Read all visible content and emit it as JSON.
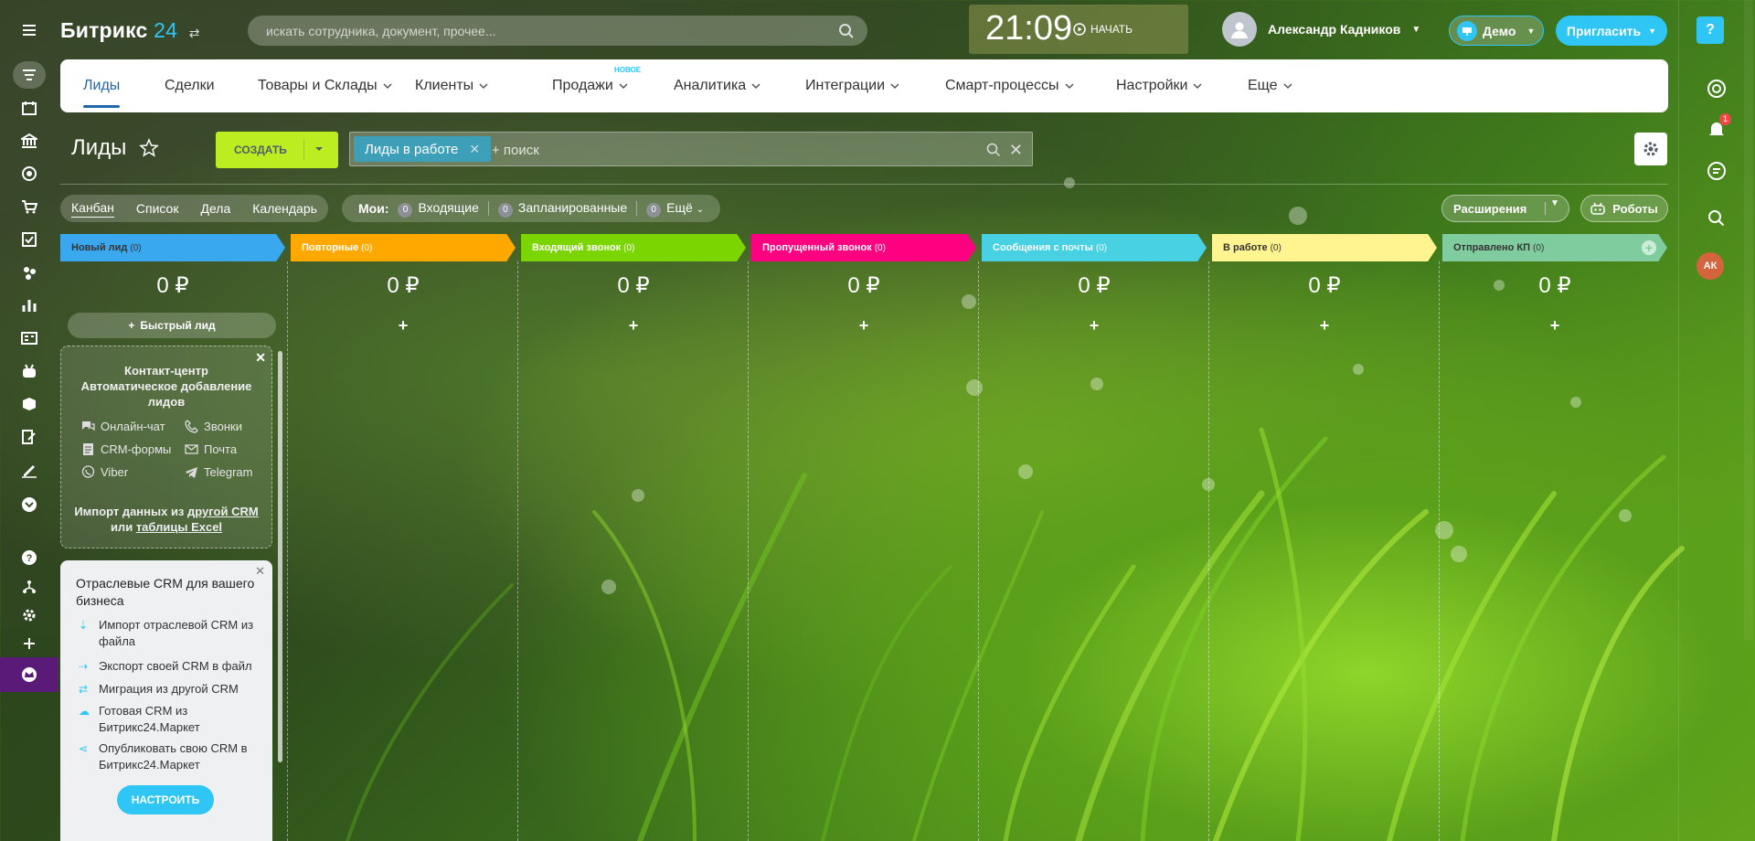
{
  "header": {
    "logo_main": "Битрикс",
    "logo_num": "24",
    "search_placeholder": "искать сотрудника, документ, прочее...",
    "clock_time": "21:09",
    "clock_action": "НАЧАТЬ",
    "user_name": "Александр Кадников",
    "demo_label": "Демо",
    "invite_label": "Пригласить",
    "help_label": "?"
  },
  "menu": {
    "items": [
      {
        "label": "Лиды"
      },
      {
        "label": "Сделки"
      },
      {
        "label": "Товары и Склады"
      },
      {
        "label": "Клиенты"
      },
      {
        "label": "Продажи"
      },
      {
        "label": "Аналитика"
      },
      {
        "label": "Интеграции"
      },
      {
        "label": "Смарт-процессы"
      },
      {
        "label": "Настройки"
      },
      {
        "label": "Еще"
      }
    ],
    "new_badge": "НОВОЕ"
  },
  "page": {
    "title": "Лиды",
    "create_label": "СОЗДАТЬ",
    "filter_tag": "Лиды в работе",
    "filter_placeholder": "+ поиск"
  },
  "views": {
    "items": [
      "Канбан",
      "Список",
      "Дела",
      "Календарь"
    ],
    "my_label": "Мои:",
    "counters": [
      {
        "count": "0",
        "label": "Входящие"
      },
      {
        "count": "0",
        "label": "Запланированные"
      },
      {
        "count": "0",
        "label": "Ещё"
      }
    ],
    "extensions_label": "Расширения",
    "robots_label": "Роботы"
  },
  "columns": [
    {
      "title": "Новый лид",
      "count": "(0)",
      "sum": "0 ₽",
      "color": "#39a8ef",
      "text_color": "#333"
    },
    {
      "title": "Повторные",
      "count": "(0)",
      "sum": "0 ₽",
      "color": "#ffa900",
      "text_color": "#fff"
    },
    {
      "title": "Входящий звонок",
      "count": "(0)",
      "sum": "0 ₽",
      "color": "#7bd500",
      "text_color": "#fff"
    },
    {
      "title": "Пропущенный звонок",
      "count": "(0)",
      "sum": "0 ₽",
      "color": "#ff0080",
      "text_color": "#fff"
    },
    {
      "title": "Сообщения с почты",
      "count": "(0)",
      "sum": "0 ₽",
      "color": "#47d1e2",
      "text_color": "#fff"
    },
    {
      "title": "В работе",
      "count": "(0)",
      "sum": "0 ₽",
      "color": "#fff48f",
      "text_color": "#333"
    },
    {
      "title": "Отправлено КП",
      "count": "(0)",
      "sum": "0 ₽",
      "color": "#7fcc9f",
      "text_color": "#333"
    }
  ],
  "quick_lead": "Быстрый лид",
  "contact_center": {
    "title": "Контакт-центр Автоматическое добавление лидов",
    "channels": [
      "Онлайн-чат",
      "Звонки",
      "CRM-формы",
      "Почта",
      "Viber",
      "Telegram"
    ],
    "import_prefix": "Импорт данных из",
    "import_link1": "другой CRM",
    "import_mid": "или",
    "import_link2": "таблицы Excel"
  },
  "industry_crm": {
    "title": "Отраслевые CRM для вашего бизнеса",
    "items": [
      "Импорт отраслевой CRM из файла",
      "Экспорт своей CRM в файл",
      "Миграция из другой CRM",
      "Готовая CRM из Битрикс24.Маркет",
      "Опубликовать свою CRM в Битрикс24.Маркет"
    ],
    "button": "НАСТРОИТЬ"
  },
  "right_bar": {
    "notification_count": "1",
    "avatar_initials": "АК"
  }
}
